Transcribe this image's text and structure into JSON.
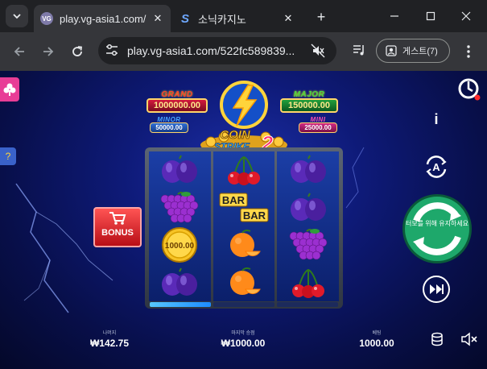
{
  "browser": {
    "tabs": [
      {
        "title": "play.vg-asia1.com/",
        "favicon": "VG",
        "active": true
      },
      {
        "title": "소닉카지노",
        "favicon": "S",
        "active": false
      }
    ],
    "url": "play.vg-asia1.com/522fc589839...",
    "profile_label": "게스트(7)"
  },
  "game": {
    "jackpots": {
      "grand": {
        "label": "GRAND",
        "value": "1000000.00"
      },
      "major": {
        "label": "MAJOR",
        "value": "150000.00"
      },
      "minor": {
        "label": "MINOR",
        "value": "50000.00"
      },
      "mini": {
        "label": "MINI",
        "value": "25000.00"
      }
    },
    "logo": {
      "line1": "COIN",
      "line2": "STRIKE",
      "num": "2"
    },
    "bonus_label": "BONUS",
    "coin_value": "1000.00",
    "bar_text": "BAR",
    "reels": [
      [
        "plum",
        "grapes",
        "coin",
        "plum"
      ],
      [
        "cherry",
        "bar",
        "orange",
        "orange"
      ],
      [
        "plum",
        "plum",
        "grapes",
        "cherry"
      ]
    ],
    "stats": {
      "balance": {
        "label": "나머지",
        "value": "₩142.75"
      },
      "win": {
        "label": "마지막 승점",
        "value": "₩1000.00"
      },
      "bet": {
        "label": "베팅",
        "value": "1000.00"
      }
    },
    "info_label": "i",
    "autoplay_letter": "A",
    "turbo_text": "터보를 위해 유지하세요",
    "colors": {
      "grand": "#d4193d",
      "major": "#22a03c",
      "minor": "#2f6fd6",
      "mini": "#d42a86",
      "turbo": "#1ea86b"
    }
  }
}
